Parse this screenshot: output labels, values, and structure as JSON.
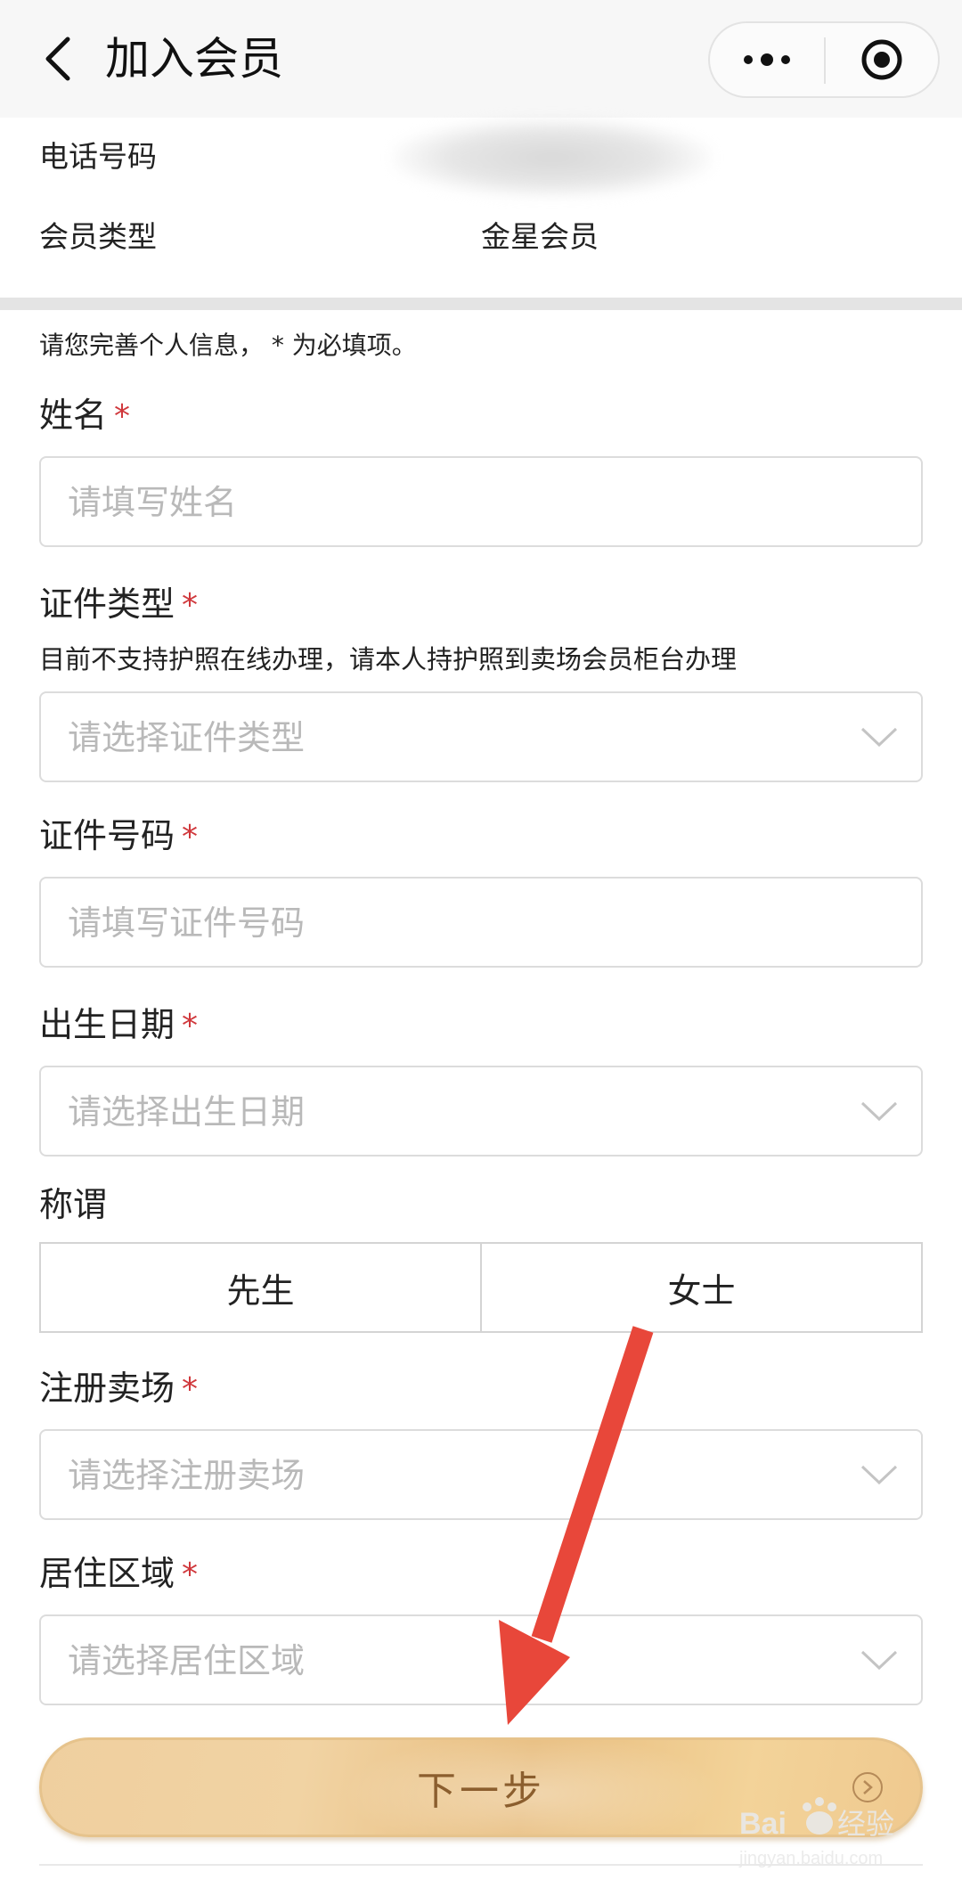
{
  "header": {
    "title": "加入会员",
    "back_icon": "chevron-left-icon",
    "more_icon": "more-dots-icon",
    "target_icon": "target-circle-icon"
  },
  "info": {
    "phone_label": "电话号码",
    "member_type_label": "会员类型",
    "member_type_value": "金星会员"
  },
  "form": {
    "note": "请您完善个人信息， * 为必填项。",
    "required_mark": "*",
    "name": {
      "label": "姓名",
      "placeholder": "请填写姓名"
    },
    "id_type": {
      "label": "证件类型",
      "hint": "目前不支持护照在线办理，请本人持护照到卖场会员柜台办理",
      "placeholder": "请选择证件类型"
    },
    "id_number": {
      "label": "证件号码",
      "placeholder": "请填写证件号码"
    },
    "birthday": {
      "label": "出生日期",
      "placeholder": "请选择出生日期"
    },
    "title": {
      "label": "称谓",
      "options": [
        "先生",
        "女士"
      ]
    },
    "store": {
      "label": "注册卖场",
      "placeholder": "请选择注册卖场"
    },
    "area": {
      "label": "居住区域",
      "placeholder": "请选择居住区域"
    }
  },
  "next_button": {
    "label": "下一步"
  },
  "watermark": {
    "brand": "Baidu经验",
    "url": "jingyan.baidu.com"
  },
  "colors": {
    "required": "#d0383c",
    "button_gold": "#ecc88f",
    "annotation_arrow": "#e8473a"
  }
}
